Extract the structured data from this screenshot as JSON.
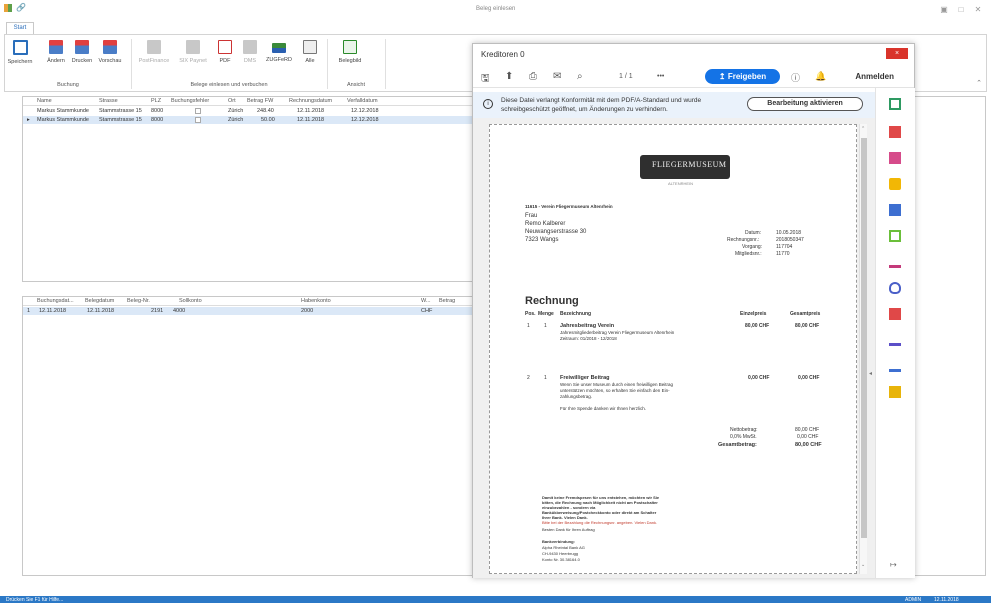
{
  "window": {
    "title": "Beleg einlesen"
  },
  "ribbon": {
    "tab": "Start",
    "buttons": [
      {
        "label": "Speichern"
      },
      {
        "label": "Ändern"
      },
      {
        "label": "Drucken"
      },
      {
        "label": "Vorschau"
      },
      {
        "label": "PostFinance"
      },
      {
        "label": "SIX Paynet"
      },
      {
        "label": "PDF"
      },
      {
        "label": "DMS"
      },
      {
        "label": "ZUGFeRD"
      },
      {
        "label": "Alle"
      },
      {
        "label": "Belegbild"
      }
    ],
    "groups": [
      "Buchung",
      "Belege einlesen und verbuchen",
      "Ansicht"
    ]
  },
  "grid1": {
    "headers": [
      "Name",
      "Strasse",
      "PLZ",
      "Buchungsfehler",
      "Ort",
      "Betrag FW",
      "Rechnungsdatum",
      "Verfalldatum"
    ],
    "rows": [
      [
        "Markus Stammkunde",
        "Stammstrasse 15",
        "8000",
        "",
        "Zürich",
        "248.40",
        "12.11.2018",
        "12.12.2018"
      ],
      [
        "Markus Stammkunde",
        "Stammstrasse 15",
        "8000",
        "",
        "Zürich",
        "50.00",
        "12.11.2018",
        "12.12.2018"
      ]
    ]
  },
  "grid2": {
    "headers": [
      "Buchungsdat...",
      "Belegdatum",
      "Beleg-Nr.",
      "Sollkonto",
      "Habenkonto",
      "W...",
      "Betrag"
    ],
    "row_index": "1",
    "rows": [
      [
        "12.11.2018",
        "12.11.2018",
        "2191",
        "4000",
        "2000",
        "CHF",
        ""
      ]
    ]
  },
  "statusbar": {
    "left": "Drücken Sie F1 für Hilfe...",
    "user": "ADMIN",
    "date": "12.11.2018"
  },
  "pdf": {
    "title": "Kreditoren 0",
    "close": "×",
    "page_indicator": "1 / 1",
    "more": "•••",
    "share": "Freigeben",
    "signin": "Anmelden",
    "info": "Diese Datei verlangt Konformität mit dem PDF/A-Standard und wurde schreibgeschützt geöffnet, um Änderungen zu verhindern.",
    "edit_button": "Bearbeitung aktivieren",
    "doc": {
      "logo": "FLIEGERMUSEUM",
      "logo_sub": "ALTENRHEIN",
      "sender": "11615 - Verein Fliegermuseum Altenrhein",
      "addr": [
        "Frau",
        "Remo Kalberer",
        "Neuwangserstrasse 30",
        "7323 Wangs"
      ],
      "meta_labels": [
        "Datum:",
        "Rechnungsnr.:",
        "Vorgang:",
        "Mitgliedsnr.:"
      ],
      "meta_values": [
        "10.05.2018",
        "2018050347",
        "117704",
        "11770"
      ],
      "heading": "Rechnung",
      "cols": [
        "Pos.",
        "Menge",
        "Bezeichnung",
        "Einzelpreis",
        "Gesamtpreis"
      ],
      "items": [
        {
          "pos": "1",
          "qty": "1",
          "name": "Jahresbeitrag Verein",
          "desc1": "Jahresmitgliederbeitrag Verein Fliegermuseum Altenrhein",
          "desc2": "Zeitraum: 01/2018 - 12/2018",
          "unit": "80,00 CHF",
          "total": "80,00 CHF"
        },
        {
          "pos": "2",
          "qty": "1",
          "name": "Freiwilliger Beitrag",
          "desc1": "Wenn Sie unser Museum durch einen freiwilligen Beitrag",
          "desc2": "unterstützen möchten, so erhalten Sie einfach den Ein-",
          "desc3": "zahlungsbetrag.",
          "unit": "0,00 CHF",
          "total": "0,00 CHF"
        }
      ],
      "thanks": "Für Ihre Spende danken wir Ihnen herzlich.",
      "totals_labels": [
        "Nettobetrag:",
        "0,0% MwSt.",
        "Gesamtbetrag:"
      ],
      "totals_values": [
        "80,00 CHF",
        "0,00 CHF",
        "80,00 CHF"
      ],
      "footer_bold": [
        "Damit keine Fremdspesen für uns entstehen, möchten wir Sie",
        "bitten, die Rechnung nach Möglichkeit nicht am Postschalter",
        "einzubezahlen - sondern via",
        "Bankükberweisung/Postcheckkonto oder direkt am Schalter",
        "Ihrer Bank. Vielen Dank."
      ],
      "footer_red": "Bitte bei der Bezahlung die Rechnungsnr. angeben. Vielen Dank.",
      "footer_thanks": "Besten Dank für Ihren Auftrag",
      "bank": [
        "Bankverbindung:",
        "Alpha Rheintal Bank AG",
        "CH-9430 Heerbrugg",
        "Konto Nr. 30.38164.0"
      ]
    }
  },
  "colors": {
    "accent": "#2b78c6",
    "share": "#1473e6",
    "close": "#d9342b",
    "selected_row": "#dbe8f7"
  }
}
